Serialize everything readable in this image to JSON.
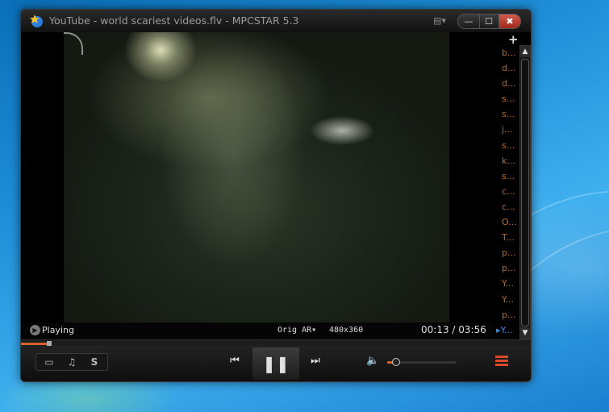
{
  "window": {
    "title": "YouTube - world scariest videos.flv - MPCSTAR 5.3",
    "menu_glyph": "▤▾",
    "minimize_glyph": "—",
    "maximize_glyph": "☐",
    "close_glyph": "✖"
  },
  "playlist": {
    "add_glyph": "+",
    "items": [
      "b...",
      "d...",
      "d...",
      "s...",
      "s...",
      "j...",
      "s...",
      "k...",
      "s...",
      "c...",
      "c...",
      "O...",
      "T...",
      "p...",
      "p...",
      "Y...",
      "Y...",
      "p...",
      "▸Y..."
    ],
    "active_index": 18,
    "scroll_up_glyph": "▲",
    "scroll_down_glyph": "▼"
  },
  "status": {
    "state": "Playing",
    "aspect_ratio": "Orig AR▾",
    "resolution": "480x360",
    "time": "00:13 / 03:56"
  },
  "seek": {
    "progress": 0.055
  },
  "controls": {
    "mode_video_glyph": "▭",
    "mode_audio_glyph": "♫",
    "mode_s_label": "S",
    "prev_glyph": "⏮",
    "pause_glyph": "❚❚",
    "next_glyph": "⏭",
    "volume_glyph": "🔈",
    "volume_level": 0.12
  },
  "colors": {
    "accent": "#d9622b",
    "playlist_text": "#c06a1e",
    "playlist_active": "#2e8ae6"
  }
}
